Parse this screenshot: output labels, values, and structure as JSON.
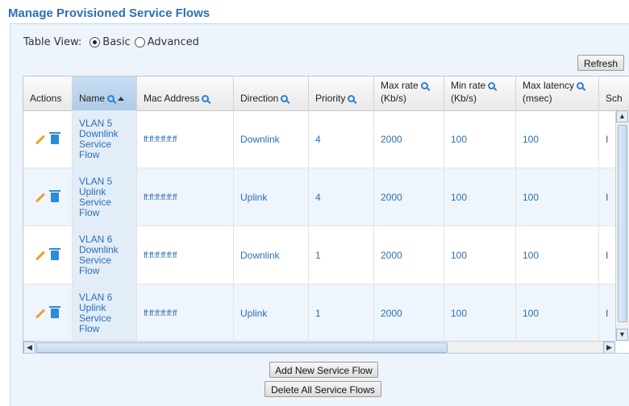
{
  "page": {
    "title": "Manage Provisioned Service Flows"
  },
  "table_view": {
    "label": "Table View:",
    "options": [
      {
        "label": "Basic",
        "selected": true
      },
      {
        "label": "Advanced",
        "selected": false
      }
    ]
  },
  "toolbar": {
    "refresh_label": "Refresh"
  },
  "table": {
    "columns": [
      {
        "label": "Actions",
        "label2": ""
      },
      {
        "label": "Name",
        "label2": ""
      },
      {
        "label": "Mac Address",
        "label2": ""
      },
      {
        "label": "Direction",
        "label2": ""
      },
      {
        "label": "Priority",
        "label2": ""
      },
      {
        "label": "(Kb/s)",
        "label2": "Max rate"
      },
      {
        "label": "(Kb/s)",
        "label2": "Min rate"
      },
      {
        "label": "(msec)",
        "label2": "Max latency"
      },
      {
        "label": "Sch",
        "label2": ""
      }
    ],
    "rows": [
      {
        "name1": "VLAN 5",
        "name2": "Downlink",
        "name3": "Service",
        "name4": "Flow",
        "mac": "ff:ff:ff:ff:ff:ff",
        "direction": "Downlink",
        "priority": "4",
        "max_rate": "2000",
        "min_rate": "100",
        "max_latency": "100",
        "sch": "I"
      },
      {
        "name1": "VLAN 5",
        "name2": "Uplink",
        "name3": "Service",
        "name4": "Flow",
        "mac": "ff:ff:ff:ff:ff:ff",
        "direction": "Uplink",
        "priority": "4",
        "max_rate": "2000",
        "min_rate": "100",
        "max_latency": "100",
        "sch": "I"
      },
      {
        "name1": "VLAN 6",
        "name2": "Downlink",
        "name3": "Service",
        "name4": "Flow",
        "mac": "ff:ff:ff:ff:ff:ff",
        "direction": "Downlink",
        "priority": "1",
        "max_rate": "2000",
        "min_rate": "100",
        "max_latency": "100",
        "sch": "I"
      },
      {
        "name1": "VLAN 6",
        "name2": "Uplink",
        "name3": "Service",
        "name4": "Flow",
        "mac": "ff:ff:ff:ff:ff:ff",
        "direction": "Uplink",
        "priority": "1",
        "max_rate": "2000",
        "min_rate": "100",
        "max_latency": "100",
        "sch": "I"
      }
    ]
  },
  "actions": {
    "add_label": "Add New Service Flow",
    "delete_all_label": "Delete All Service Flows"
  },
  "icons": {
    "edit": "pencil-icon",
    "delete": "trash-icon",
    "search": "magnifier-icon",
    "sort": "sort-ascending-icon"
  },
  "colors": {
    "accent": "#2d6fb3",
    "panel_bg": "#eef4fb",
    "name_col_bg": "#e2edf8"
  }
}
